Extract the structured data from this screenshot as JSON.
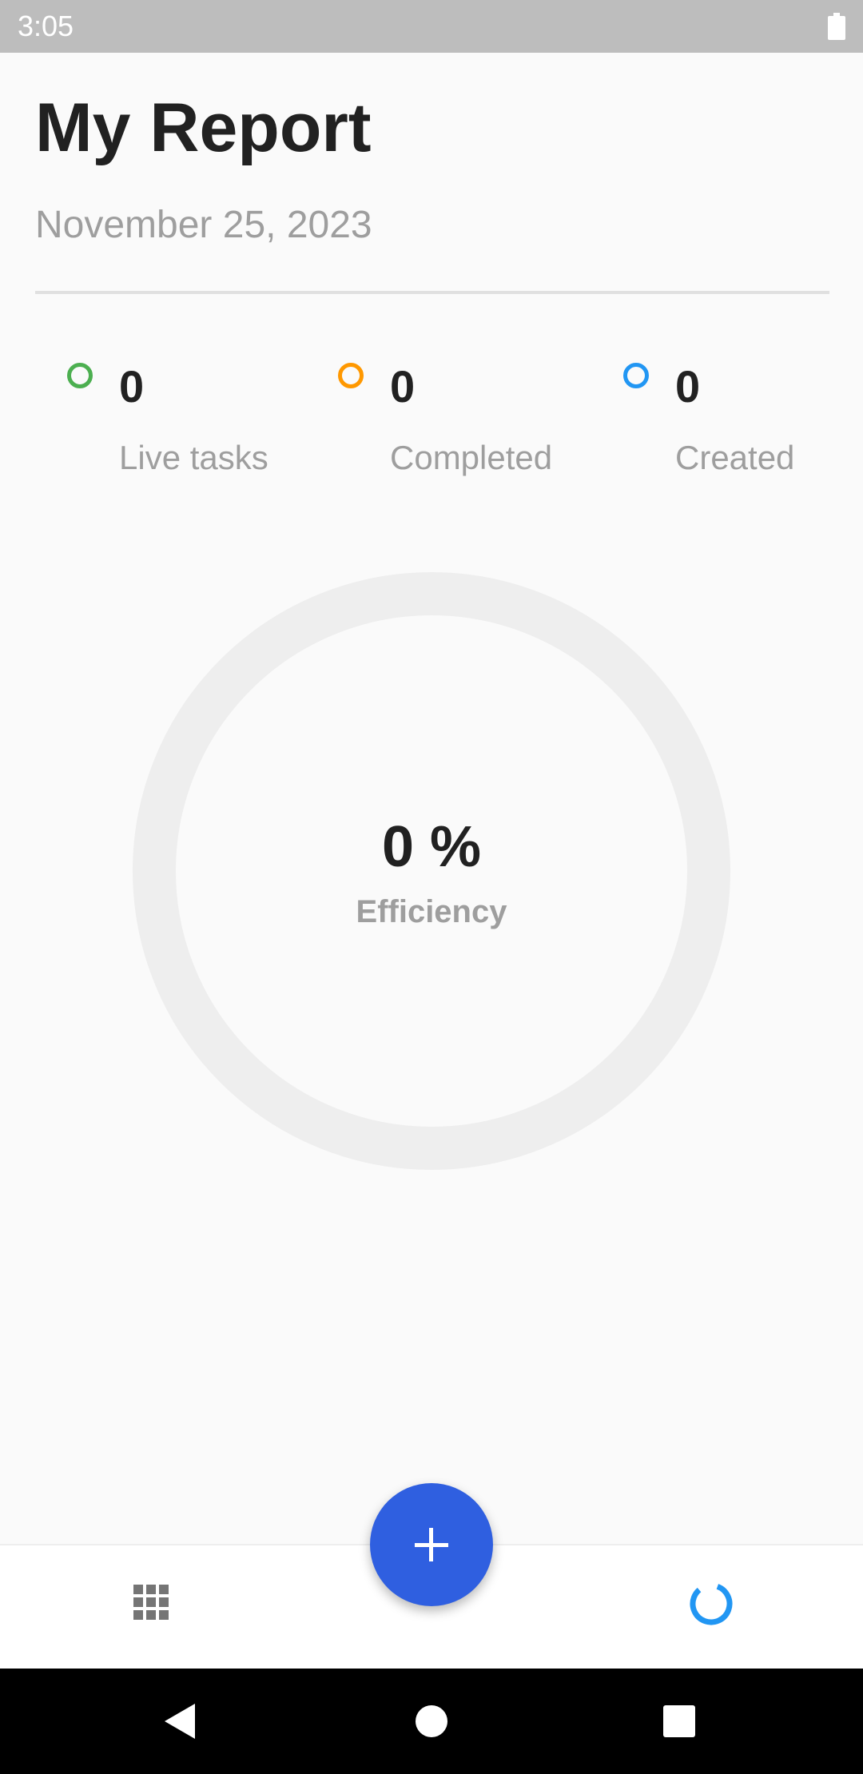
{
  "status_bar": {
    "time": "3:05"
  },
  "header": {
    "title": "My Report",
    "date": "November 25, 2023"
  },
  "stats": [
    {
      "value": "0",
      "label": "Live tasks",
      "color": "#4caf50"
    },
    {
      "value": "0",
      "label": "Completed",
      "color": "#ff9800"
    },
    {
      "value": "0",
      "label": "Created",
      "color": "#2196f3"
    }
  ],
  "efficiency": {
    "value": "0 %",
    "label": "Efficiency",
    "percent": 0
  },
  "bottom_nav": {
    "items": [
      {
        "icon": "grid-icon"
      },
      {
        "icon": "report-icon",
        "color": "#2196f3"
      }
    ],
    "fab": {
      "icon": "plus-icon",
      "color": "#2f5fe0"
    }
  },
  "system_nav": {
    "icons": [
      "back-icon",
      "home-icon",
      "recents-icon"
    ]
  }
}
